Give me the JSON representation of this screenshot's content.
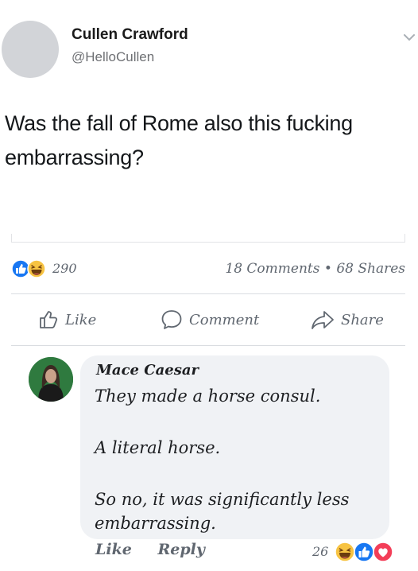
{
  "tweet": {
    "name": "Cullen Crawford",
    "handle": "@HelloCullen",
    "text": "Was the fall of Rome also this fucking embarrassing?"
  },
  "post_stats": {
    "reaction_count": "290",
    "comments": "18 Comments",
    "separator": "•",
    "shares": "68 Shares",
    "reaction_icons": [
      "like-icon",
      "haha-icon"
    ]
  },
  "actions": {
    "like": "Like",
    "comment": "Comment",
    "share": "Share"
  },
  "comment": {
    "author": "Mace Caesar",
    "paragraphs": [
      "They made a horse consul.",
      "A literal horse.",
      "So no, it was significantly less embarrassing."
    ],
    "like_label": "Like",
    "reply_label": "Reply",
    "reaction_count": "26",
    "reaction_icons": [
      "haha-icon",
      "like-icon",
      "love-icon"
    ]
  },
  "colors": {
    "like_blue": "#1877f2",
    "haha_yellow": "#f7c342",
    "love_red": "#f33e58",
    "muted_text": "#606770",
    "bubble_bg": "#f0f2f5"
  }
}
